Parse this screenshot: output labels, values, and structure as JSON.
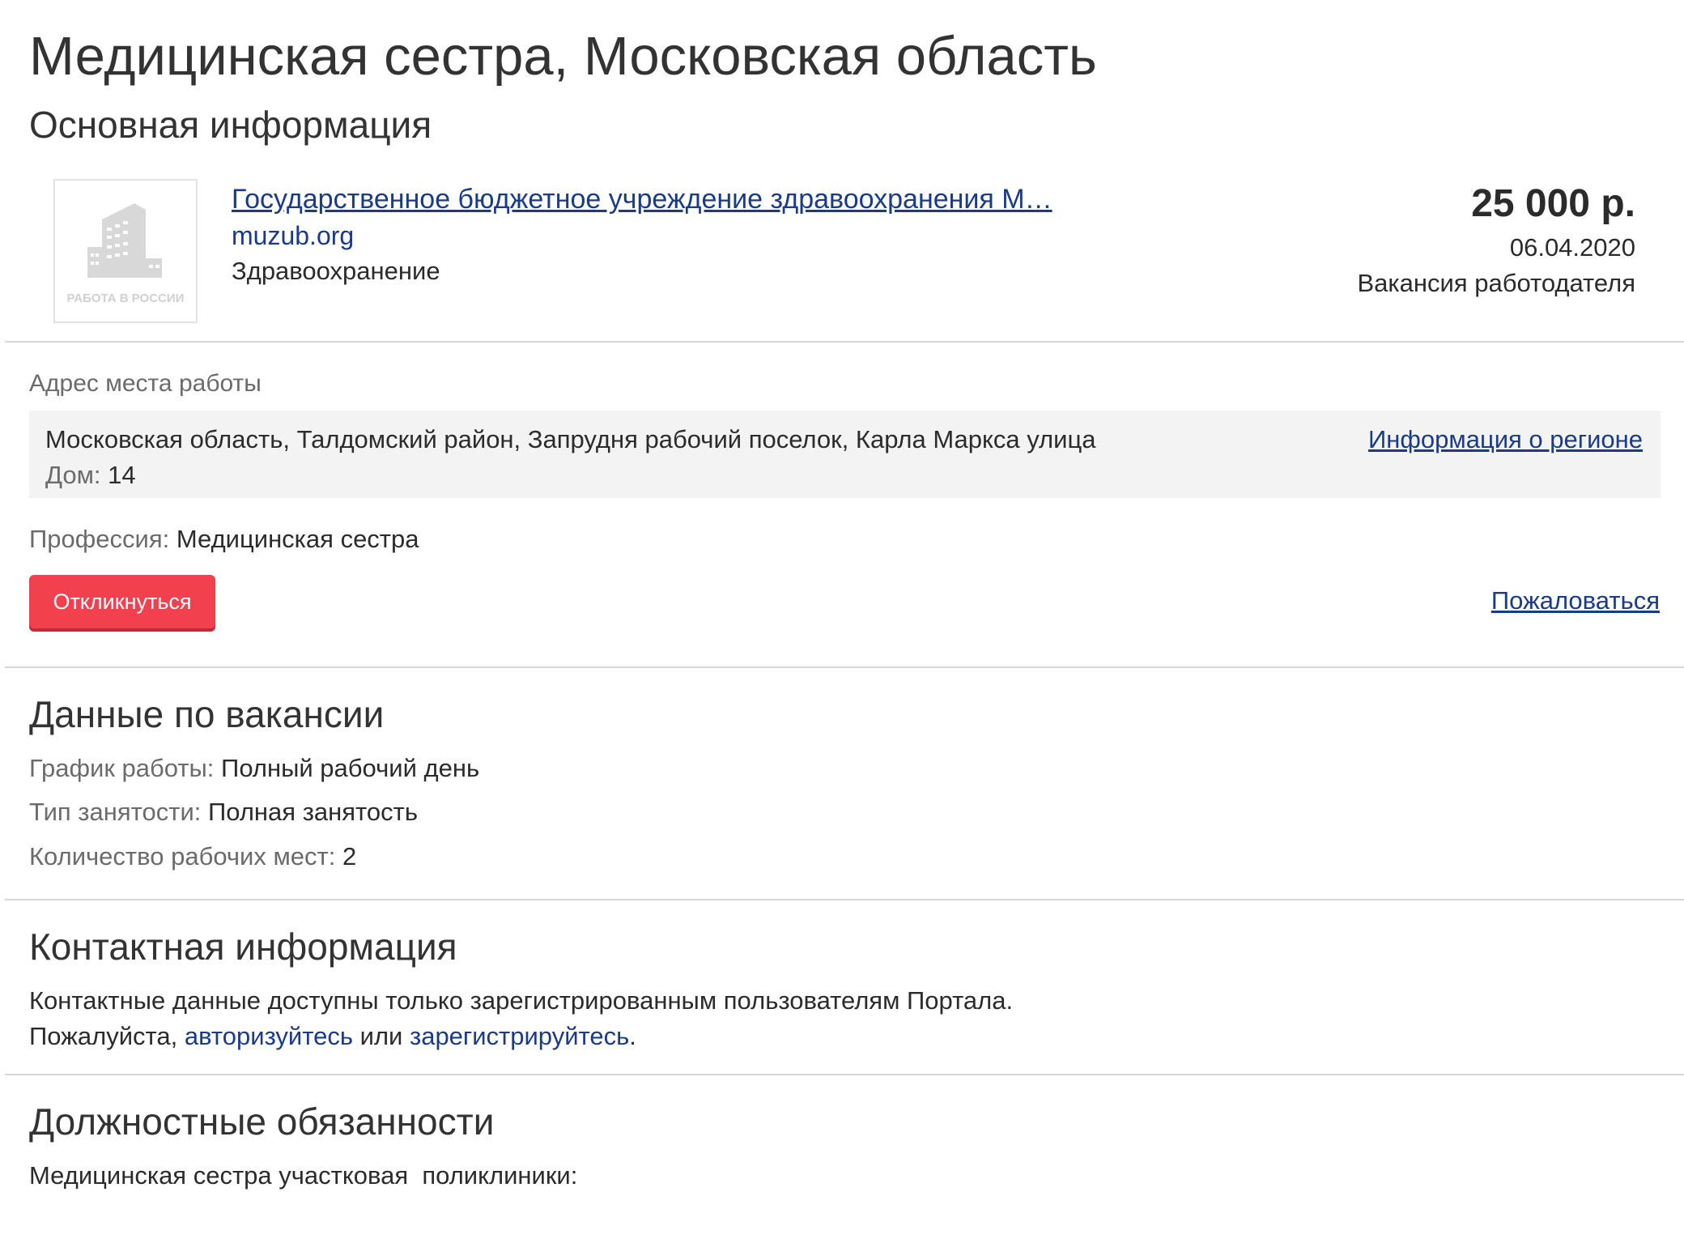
{
  "page": {
    "title": "Медицинская сестра, Московская область",
    "subtitle": "Основная информация"
  },
  "company": {
    "logo_text": "РАБОТА В РОССИИ",
    "name": "Государственное бюджетное учреждение здравоохранения М…",
    "site": "muzub.org",
    "industry": "Здравоохранение"
  },
  "vacancy_meta": {
    "salary": "25 000 р.",
    "date": "06.04.2020",
    "type": "Вакансия работодателя"
  },
  "address": {
    "label": "Адрес места работы",
    "line": "Московская область, Талдомский район, Запрудня рабочий поселок, Карла Маркса улица",
    "house_label": "Дом:",
    "house_value": "14",
    "region_link": "Информация о регионе"
  },
  "profession": {
    "label": "Профессия:",
    "value": "Медицинская сестра"
  },
  "actions": {
    "respond_label": "Откликнуться",
    "complain_label": "Пожаловаться"
  },
  "vacancy_data": {
    "title": "Данные по вакансии",
    "fields": [
      {
        "label": "График работы:",
        "value": "Полный рабочий день"
      },
      {
        "label": "Тип занятости:",
        "value": "Полная занятость"
      },
      {
        "label": "Количество рабочих мест:",
        "value": "2"
      }
    ]
  },
  "contacts": {
    "title": "Контактная информация",
    "notice": "Контактные данные доступны только зарегистрированным пользователям Портала.",
    "please": "Пожалуйста,",
    "login_link": "авторизуйтесь",
    "or": "или",
    "register_link": "зарегистрируйтесь",
    "end": "."
  },
  "duties": {
    "title": "Должностные обязанности",
    "text": "Медицинская сестра участковая  поликлиники:"
  }
}
